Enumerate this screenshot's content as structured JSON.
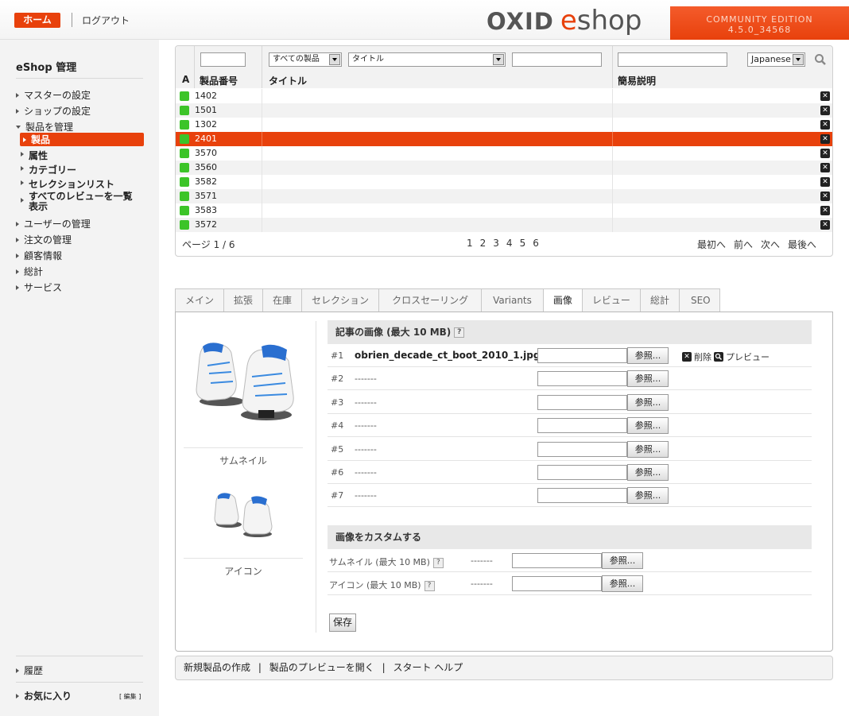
{
  "header": {
    "home": "ホーム",
    "logout": "ログアウト",
    "logo_oxid": "OXID",
    "logo_e": "e",
    "logo_shop": "shop",
    "edition": "COMMUNITY EDITION",
    "version": "4.5.0_34568"
  },
  "sidebar": {
    "title": "eShop 管理",
    "items": [
      {
        "label": "マスターの設定"
      },
      {
        "label": "ショップの設定"
      },
      {
        "label": "製品を管理"
      },
      {
        "label": "ユーザーの管理"
      },
      {
        "label": "注文の管理"
      },
      {
        "label": "顧客情報"
      },
      {
        "label": "総計"
      },
      {
        "label": "サービス"
      }
    ],
    "subitems": [
      {
        "label": "製品"
      },
      {
        "label": "属性"
      },
      {
        "label": "カテゴリー"
      },
      {
        "label": "セレクションリスト"
      },
      {
        "label": "すべてのレビューを一覧表示"
      }
    ],
    "history": "履歴",
    "favorites": "お気に入り",
    "edit": "[ 編集 ]"
  },
  "list": {
    "category_select": "すべての製品",
    "field_select": "タイトル",
    "language_select": "Japanese",
    "col_active": "A",
    "col_number": "製品番号",
    "col_title": "タイトル",
    "col_short": "簡易説明",
    "rows": [
      {
        "num": "1402"
      },
      {
        "num": "1501"
      },
      {
        "num": "1302"
      },
      {
        "num": "2401"
      },
      {
        "num": "3570"
      },
      {
        "num": "3560"
      },
      {
        "num": "3582"
      },
      {
        "num": "3571"
      },
      {
        "num": "3583"
      },
      {
        "num": "3572"
      }
    ],
    "selected_index": 3,
    "page_label": "ページ 1 / 6",
    "pages": [
      "1",
      "2",
      "3",
      "4",
      "5",
      "6"
    ],
    "nav": {
      "first": "最初へ",
      "prev": "前へ",
      "next": "次へ",
      "last": "最後へ"
    }
  },
  "tabs": [
    "メイン",
    "拡張",
    "在庫",
    "セレクション",
    "クロスセーリング",
    "Variants",
    "画像",
    "レビュー",
    "総計",
    "SEO"
  ],
  "active_tab": 6,
  "images": {
    "section_title": "記事の画像 (最大 10 MB)",
    "rows": [
      {
        "num": "#1",
        "file": "obrien_decade_ct_boot_2010_1.jpg"
      },
      {
        "num": "#2",
        "file": "-------"
      },
      {
        "num": "#3",
        "file": "-------"
      },
      {
        "num": "#4",
        "file": "-------"
      },
      {
        "num": "#5",
        "file": "-------"
      },
      {
        "num": "#6",
        "file": "-------"
      },
      {
        "num": "#7",
        "file": "-------"
      }
    ],
    "browse": "参照...",
    "delete": "削除",
    "preview": "プレビュー",
    "custom_title": "画像をカスタムする",
    "custom_rows": [
      {
        "label": "サムネイル (最大 10 MB)",
        "value": "-------"
      },
      {
        "label": "アイコン (最大 10 MB)",
        "value": "-------"
      }
    ],
    "save": "保存",
    "thumb_caption": "サムネイル",
    "icon_caption": "アイコン",
    "help": "?"
  },
  "footer": {
    "new_product": "新規製品の作成",
    "preview": "製品のプレビューを開く",
    "help": "スタート ヘルプ",
    "sep": "|"
  },
  "colors": {
    "accent": "#e8410c",
    "active_dot": "#3cc428"
  }
}
